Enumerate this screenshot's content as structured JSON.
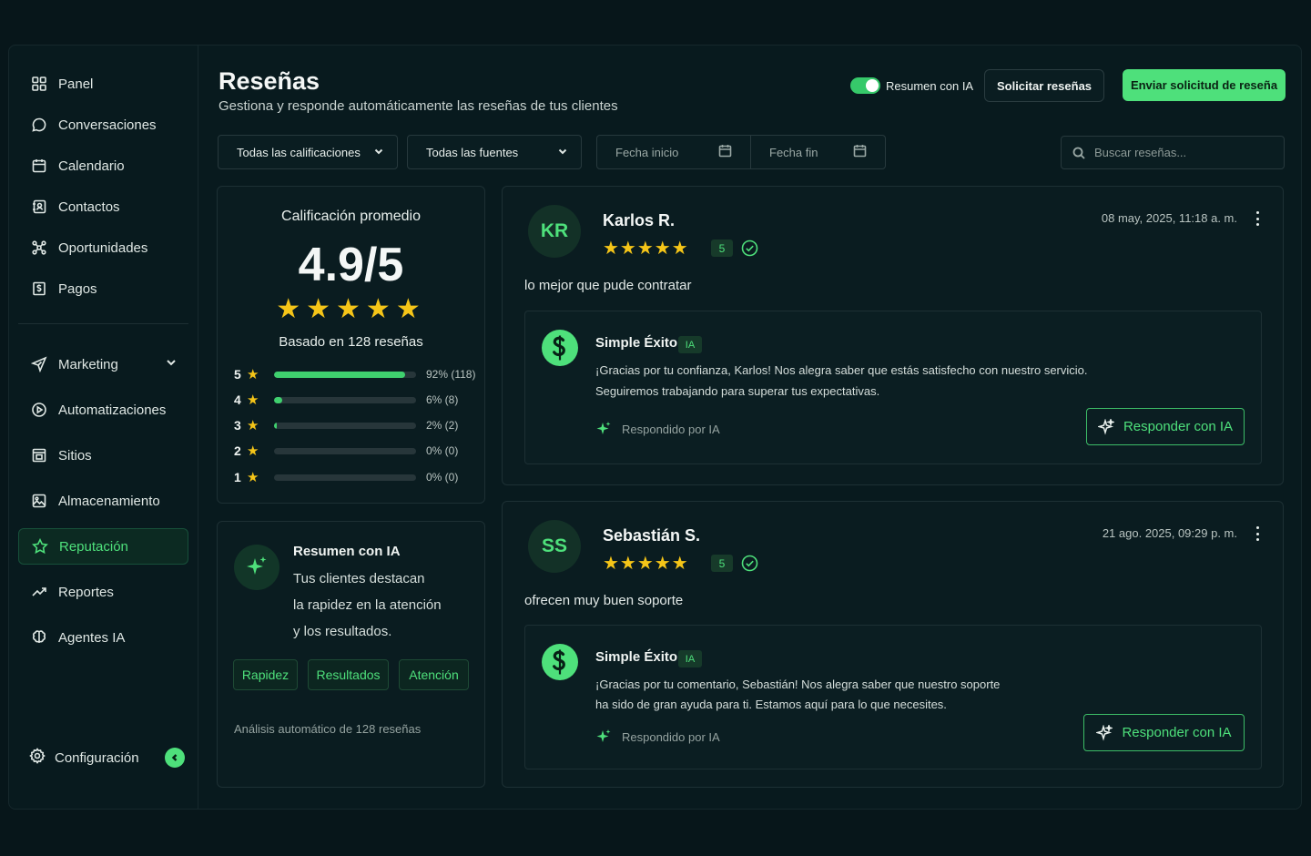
{
  "sidebar": {
    "items": [
      {
        "label": "Panel",
        "icon": "grid-icon"
      },
      {
        "label": "Conversaciones",
        "icon": "chat-bubble-icon"
      },
      {
        "label": "Calendario",
        "icon": "calendar-icon"
      },
      {
        "label": "Contactos",
        "icon": "contacts-icon"
      },
      {
        "label": "Oportunidades",
        "icon": "network-icon"
      },
      {
        "label": "Pagos",
        "icon": "dollar-receipt-icon"
      },
      {
        "label": "Marketing",
        "icon": "send-icon"
      },
      {
        "label": "Automatizaciones",
        "icon": "play-circle-icon"
      },
      {
        "label": "Sitios",
        "icon": "browser-icon"
      },
      {
        "label": "Almacenamiento",
        "icon": "image-icon"
      },
      {
        "label": "Reputación",
        "icon": "star-icon",
        "active": true
      },
      {
        "label": "Reportes",
        "icon": "trend-icon"
      },
      {
        "label": "Agentes IA",
        "icon": "brain-icon"
      }
    ],
    "config_label": "Configuración"
  },
  "header": {
    "title": "Reseñas",
    "subtitle": "Gestiona y responde automáticamente las reseñas de tus clientes",
    "toggle_label": "Resumen con IA",
    "toggle_on": true,
    "request_button": "Solicitar reseñas",
    "send_button": "Enviar solicitud de reseña"
  },
  "filters": {
    "ratings_select": "Todas las calificaciones",
    "sources_select": "Todas las fuentes",
    "date_start": "Fecha inicio",
    "date_end": "Fecha fin",
    "search_placeholder": "Buscar reseñas..."
  },
  "rating_summary": {
    "title": "Calificación promedio",
    "score": "4.9/5",
    "stars": "★★★★★",
    "based_on": "Basado en 128 reseñas",
    "distribution": [
      {
        "stars": "5",
        "percent": 92,
        "label": "92% (118)"
      },
      {
        "stars": "4",
        "percent": 6,
        "label": "6% (8)"
      },
      {
        "stars": "3",
        "percent": 2,
        "label": "2% (2)"
      },
      {
        "stars": "2",
        "percent": 0,
        "label": "0% (0)"
      },
      {
        "stars": "1",
        "percent": 0,
        "label": "0% (0)"
      }
    ]
  },
  "ai_summary": {
    "title": "Resumen con IA",
    "lines": [
      "Tus clientes destacan",
      "la rapidez en la atención",
      "y los resultados."
    ],
    "tags": [
      "Rapidez",
      "Resultados",
      "Atención"
    ],
    "footer": "Análisis automático de 128 reseñas"
  },
  "reviews": [
    {
      "initials": "KR",
      "name": "Karlos R.",
      "stars": "★★★★★",
      "rating": "5",
      "date": "08 may, 2025, 11:18 a. m.",
      "text": "lo mejor que pude contratar",
      "reply": {
        "author": "Simple Éxito",
        "badge": "IA",
        "lines": [
          "¡Gracias por tu confianza, Karlos! Nos alegra saber que estás satisfecho con nuestro servicio.",
          "Seguiremos trabajando para superar tus expectativas."
        ],
        "by": "Respondido por IA",
        "button": "Responder con IA"
      }
    },
    {
      "initials": "SS",
      "name": "Sebastián S.",
      "stars": "★★★★★",
      "rating": "5",
      "date": "21 ago. 2025, 09:29 p. m.",
      "text": "ofrecen muy buen soporte",
      "reply": {
        "author": "Simple Éxito",
        "badge": "IA",
        "lines": [
          "¡Gracias por tu comentario, Sebastián! Nos alegra saber que nuestro soporte",
          "ha sido de gran ayuda para ti. Estamos aquí para lo que necesites."
        ],
        "by": "Respondido por IA",
        "button": "Responder con IA"
      }
    }
  ],
  "colors": {
    "accent": "#4ee07b",
    "star": "#f5c518",
    "background": "#07161a"
  }
}
